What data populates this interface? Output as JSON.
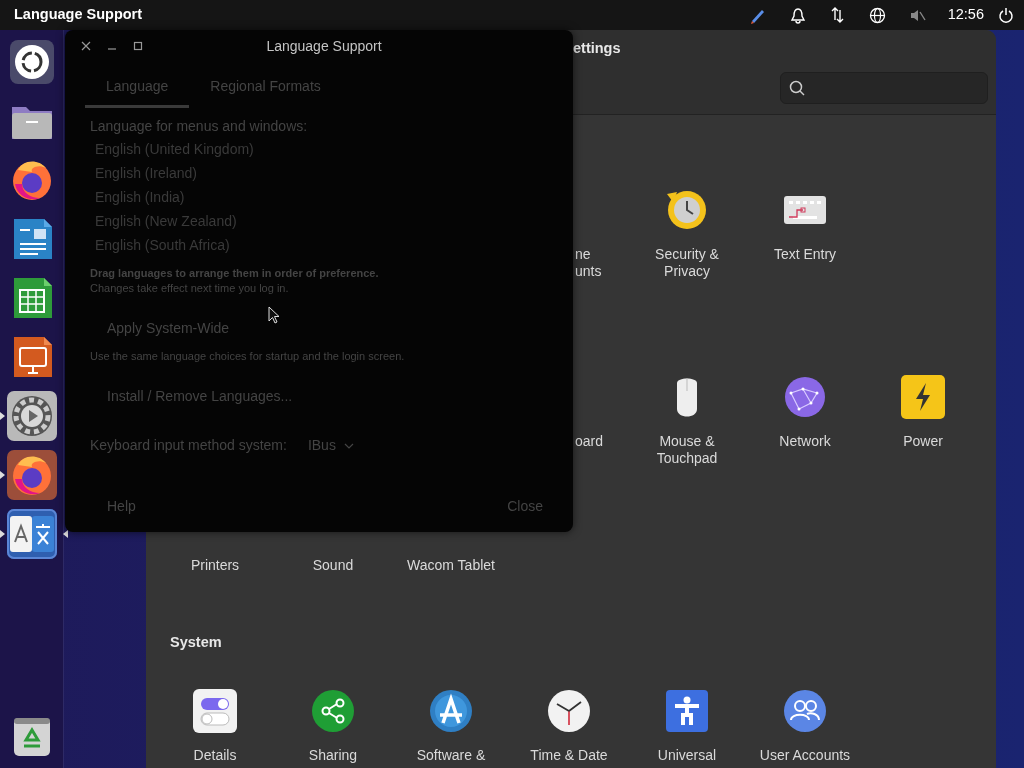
{
  "topbar": {
    "title": "Language Support",
    "clock": "12:56"
  },
  "dock": {
    "items": [
      {
        "kind": "ubuntu",
        "running": false,
        "focused": false
      },
      {
        "kind": "files",
        "running": false,
        "focused": false
      },
      {
        "kind": "firefox",
        "running": false,
        "focused": false
      },
      {
        "kind": "writer",
        "running": false,
        "focused": false
      },
      {
        "kind": "calc",
        "running": false,
        "focused": false
      },
      {
        "kind": "impress",
        "running": false,
        "focused": false
      },
      {
        "kind": "settings",
        "running": true,
        "focused": false
      },
      {
        "kind": "firefox",
        "running": true,
        "focused": false
      },
      {
        "kind": "language",
        "running": true,
        "focused": true
      }
    ],
    "trash": {
      "kind": "trash"
    }
  },
  "settings": {
    "title": "ettings",
    "rows": [
      [
        {
          "kind": "partial",
          "label": "ne\nunts"
        },
        {
          "kind": "security",
          "label": "Security &\nPrivacy"
        },
        {
          "kind": "text-entry",
          "label": "Text Entry"
        }
      ],
      [
        {
          "kind": "partial",
          "label": "oard"
        },
        {
          "kind": "mouse",
          "label": "Mouse &\nTouchpad"
        },
        {
          "kind": "network",
          "label": "Network"
        },
        {
          "kind": "power",
          "label": "Power"
        }
      ],
      [
        {
          "kind": "covered",
          "label": "Printers"
        },
        {
          "kind": "covered",
          "label": "Sound"
        },
        {
          "kind": "covered",
          "label": "Wacom Tablet"
        }
      ]
    ],
    "system": {
      "heading": "System",
      "items": [
        {
          "kind": "details",
          "label": "Details"
        },
        {
          "kind": "sharing",
          "label": "Sharing"
        },
        {
          "kind": "software",
          "label": "Software &"
        },
        {
          "kind": "clock",
          "label": "Time & Date"
        },
        {
          "kind": "access",
          "label": "Universal"
        },
        {
          "kind": "users",
          "label": "User Accounts"
        }
      ]
    }
  },
  "dialog": {
    "title": "Language Support",
    "tabs": [
      {
        "label": "Language",
        "selected": true
      },
      {
        "label": "Regional Formats",
        "selected": false
      }
    ],
    "list_label": "Language for menus and windows:",
    "languages": [
      "English (United Kingdom)",
      "English (Ireland)",
      "English (India)",
      "English (New Zealand)",
      "English (South Africa)"
    ],
    "hint": "Drag languages to arrange them in order of preference.",
    "hint_note": "Changes take effect next time you log in.",
    "apply_button": "Apply System-Wide",
    "apply_hint": "Use the same language choices for startup and the login screen.",
    "install_button": "Install / Remove Languages...",
    "input_method": {
      "label": "Keyboard input method system:",
      "value": "IBus"
    },
    "help_button": "Help",
    "close_button": "Close"
  }
}
